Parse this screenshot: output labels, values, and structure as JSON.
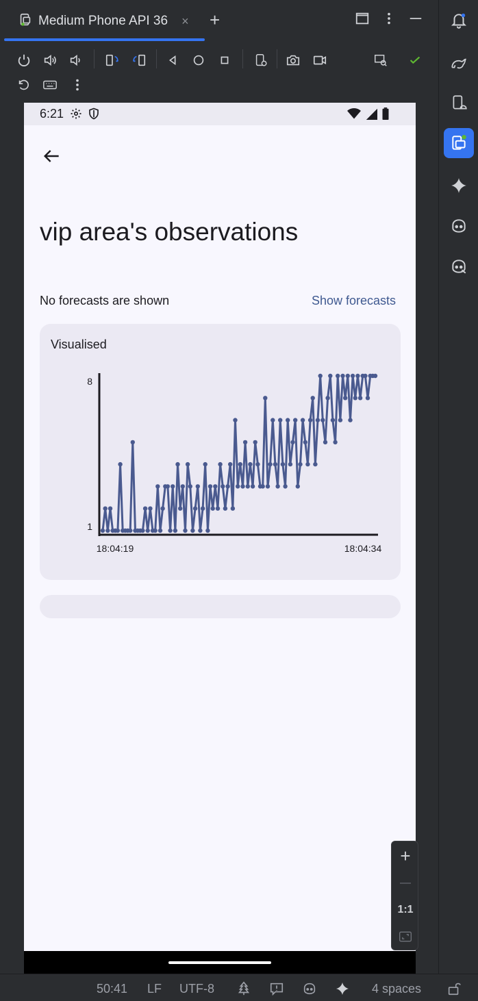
{
  "tab": {
    "title": "Medium Phone API 36",
    "close_glyph": "×",
    "add_glyph": "+"
  },
  "toolbar": {
    "icons": [
      "power-icon",
      "volume-up-icon",
      "volume-down-icon",
      "rotate-left-icon",
      "rotate-right-icon",
      "back-icon",
      "home-icon",
      "overview-icon",
      "device-settings-icon",
      "screenshot-icon",
      "screen-record-icon",
      "display-mirror-icon",
      "check-icon",
      "reset-icon",
      "keyboard-icon",
      "more-icon"
    ]
  },
  "rightstrip": {
    "icons": [
      "notifications-icon",
      "gradle-icon",
      "device-manager-icon",
      "running-devices-icon",
      "gemini-icon",
      "copilot-icon",
      "copilot-chat-icon"
    ]
  },
  "device": {
    "status": {
      "time": "6:21"
    },
    "title": "vip area's observations",
    "forecast_status": "No forecasts are shown",
    "forecast_action": "Show forecasts",
    "card_title": "Visualised"
  },
  "chart_data": {
    "type": "line",
    "title": "",
    "xlabel": "",
    "ylabel": "",
    "x_tick_labels": [
      "18:04:19",
      "18:04:34"
    ],
    "y_tick_labels": [
      "1",
      "8"
    ],
    "ylim": [
      1,
      8
    ],
    "color": "#4a5a8f",
    "series": [
      {
        "values": [
          1,
          2,
          1,
          2,
          1,
          1,
          1,
          4,
          1,
          1,
          1,
          1,
          5,
          1,
          1,
          1,
          1,
          2,
          1,
          2,
          1,
          1,
          3,
          1,
          2,
          3,
          3,
          1,
          3,
          1,
          4,
          2,
          3,
          1,
          4,
          3,
          1,
          2,
          3,
          1,
          2,
          4,
          1,
          3,
          2,
          3,
          2,
          4,
          3,
          2,
          3,
          4,
          2,
          6,
          3,
          4,
          3,
          5,
          3,
          4,
          3,
          5,
          4,
          3,
          3,
          7,
          3,
          4,
          6,
          4,
          3,
          6,
          4,
          3,
          6,
          4,
          5,
          6,
          3,
          4,
          6,
          5,
          4,
          6,
          7,
          4,
          6,
          8,
          6,
          5,
          7,
          8,
          6,
          5,
          8,
          6,
          8,
          7,
          8,
          6,
          8,
          7,
          8,
          7,
          8,
          8,
          7,
          8,
          8,
          8
        ]
      }
    ],
    "grid": false,
    "legend": "none"
  },
  "zoom": {
    "zoom_in": "+",
    "zoom_out": "—",
    "actual": "1:1"
  },
  "ide_status": {
    "position": "50:41",
    "line_ending": "LF",
    "encoding": "UTF-8",
    "indent": "4 spaces"
  }
}
